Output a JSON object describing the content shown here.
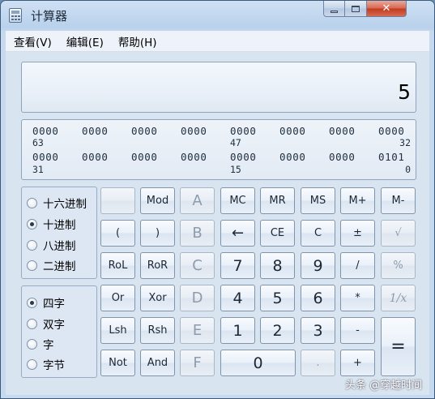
{
  "window": {
    "title": "计算器"
  },
  "menu": [
    {
      "label": "查看(V)"
    },
    {
      "label": "编辑(E)"
    },
    {
      "label": "帮助(H)"
    }
  ],
  "display": {
    "value": "5"
  },
  "binary": {
    "row1": {
      "groups": [
        "0000",
        "0000",
        "0000",
        "0000",
        "0000",
        "0000",
        "0000",
        "0000"
      ],
      "pos_left": "63",
      "pos_mid": "47",
      "pos_right": "32"
    },
    "row2": {
      "groups": [
        "0000",
        "0000",
        "0000",
        "0000",
        "0000",
        "0000",
        "0000",
        "0101"
      ],
      "pos_left": "31",
      "pos_mid": "15",
      "pos_right": "0"
    }
  },
  "base_options": [
    {
      "label": "十六进制",
      "selected": false
    },
    {
      "label": "十进制",
      "selected": true
    },
    {
      "label": "八进制",
      "selected": false
    },
    {
      "label": "二进制",
      "selected": false
    }
  ],
  "word_options": [
    {
      "label": "四字",
      "selected": true
    },
    {
      "label": "双字",
      "selected": false
    },
    {
      "label": "字",
      "selected": false
    },
    {
      "label": "字节",
      "selected": false
    }
  ],
  "buttons": {
    "blank": "",
    "mod": "Mod",
    "a": "A",
    "mc": "MC",
    "mr": "MR",
    "ms": "MS",
    "mplus": "M+",
    "mminus": "M-",
    "lparen": "(",
    "rparen": ")",
    "b": "B",
    "backspace": "←",
    "ce": "CE",
    "c": "C",
    "plusminus": "±",
    "sqrt": "√",
    "rol": "RoL",
    "ror": "RoR",
    "hexc": "C",
    "n7": "7",
    "n8": "8",
    "n9": "9",
    "divide": "/",
    "percent": "%",
    "or": "Or",
    "xor": "Xor",
    "d": "D",
    "n4": "4",
    "n5": "5",
    "n6": "6",
    "multiply": "*",
    "reciprocal": "1/x",
    "lsh": "Lsh",
    "rsh": "Rsh",
    "e": "E",
    "n1": "1",
    "n2": "2",
    "n3": "3",
    "minus": "-",
    "equals": "=",
    "not": "Not",
    "and": "And",
    "f": "F",
    "n0": "0",
    "dot": ".",
    "plus": "+"
  },
  "watermark": "头条 @穿越时间"
}
